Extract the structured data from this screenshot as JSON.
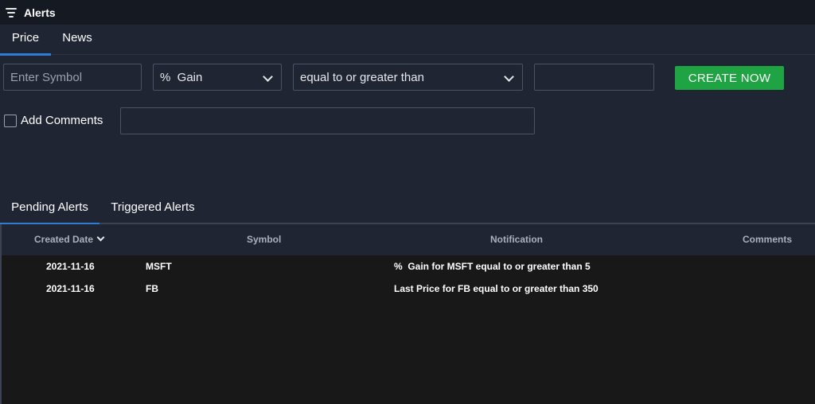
{
  "window": {
    "title": "Alerts",
    "icon": "filter-icon"
  },
  "top_tabs": [
    {
      "label": "Price",
      "active": true
    },
    {
      "label": "News",
      "active": false
    }
  ],
  "form": {
    "symbol_placeholder": "Enter Symbol",
    "metric_selected": "%  Gain",
    "condition_selected": "equal to or greater than",
    "value": "",
    "create_label": "CREATE NOW",
    "comments_label": "Add Comments",
    "comments_value": ""
  },
  "bottom_tabs": [
    {
      "label": "Pending Alerts",
      "active": true
    },
    {
      "label": "Triggered Alerts",
      "active": false
    }
  ],
  "table": {
    "columns": [
      "Created Date",
      "Symbol",
      "Notification",
      "Comments"
    ],
    "rows": [
      {
        "date": "2021-11-16",
        "symbol": "MSFT",
        "notification": "%  Gain for MSFT equal to or greater than 5",
        "comments": ""
      },
      {
        "date": "2021-11-16",
        "symbol": "FB",
        "notification": "Last Price for FB equal to or greater than 350",
        "comments": ""
      }
    ]
  },
  "colors": {
    "accent": "#2f7bd6",
    "create": "#1fa443",
    "background": "#1f2532",
    "table_bg": "#181818"
  }
}
